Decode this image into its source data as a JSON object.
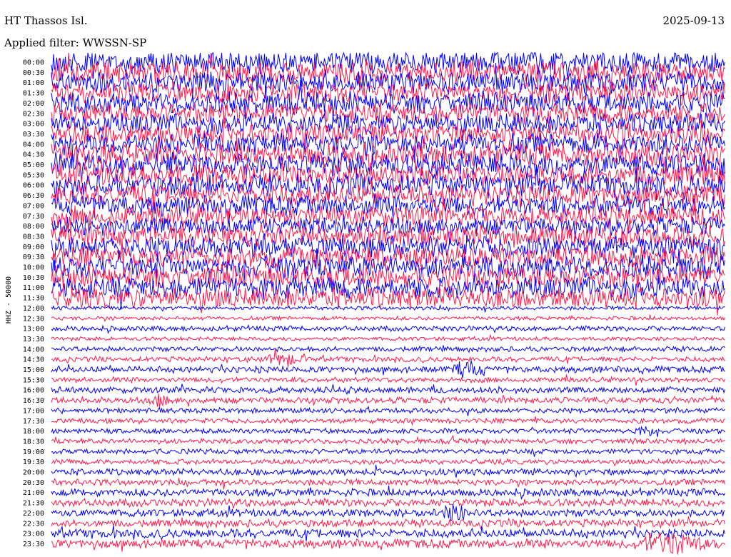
{
  "header": {
    "station": "HT Thassos Isl.",
    "date": "2025-09-13",
    "filter": "Applied filter: WWSSN-SP"
  },
  "chart_data": {
    "type": "line",
    "ylabel": "HHZ - 50000",
    "rows": [
      "00:00",
      "00:30",
      "01:00",
      "01:30",
      "02:00",
      "02:30",
      "03:00",
      "03:30",
      "04:00",
      "04:30",
      "05:00",
      "05:30",
      "06:00",
      "06:30",
      "07:00",
      "07:30",
      "08:00",
      "08:30",
      "09:00",
      "09:30",
      "10:00",
      "10:30",
      "11:00",
      "11:30",
      "12:00",
      "12:30",
      "13:00",
      "13:30",
      "14:00",
      "14:30",
      "15:00",
      "15:30",
      "16:00",
      "16:30",
      "17:00",
      "17:30",
      "18:00",
      "18:30",
      "19:00",
      "19:30",
      "20:00",
      "20:30",
      "21:00",
      "21:30",
      "22:00",
      "22:30",
      "23:00",
      "23:30"
    ],
    "colors": [
      "#0000ff",
      "#ff1a4a"
    ],
    "noise": [
      18,
      18,
      17,
      17,
      17,
      16,
      16,
      16,
      17,
      18,
      18,
      18,
      17,
      17,
      16,
      16,
      15,
      17,
      17,
      17,
      18,
      18,
      17,
      16,
      3,
      3,
      4,
      3,
      4,
      4,
      5,
      4,
      5,
      5,
      4,
      4,
      4,
      4,
      4,
      4,
      5,
      5,
      6,
      6,
      6,
      6,
      7,
      7
    ],
    "events": [
      {
        "row": 0,
        "x": 0.72,
        "width": 0.12,
        "amp": 28
      },
      {
        "row": 7,
        "x": 0.85,
        "width": 0.12,
        "amp": 22
      },
      {
        "row": 15,
        "x": 0.95,
        "width": 0.3,
        "amp": 18
      },
      {
        "row": 29,
        "x": 0.35,
        "width": 0.06,
        "amp": 14
      },
      {
        "row": 30,
        "x": 0.62,
        "width": 0.05,
        "amp": 18
      },
      {
        "row": 33,
        "x": 0.16,
        "width": 0.03,
        "amp": 16
      },
      {
        "row": 36,
        "x": 0.88,
        "width": 0.04,
        "amp": 12
      },
      {
        "row": 44,
        "x": 0.6,
        "width": 0.04,
        "amp": 22
      },
      {
        "row": 47,
        "x": 0.92,
        "width": 0.1,
        "amp": 25
      }
    ]
  }
}
